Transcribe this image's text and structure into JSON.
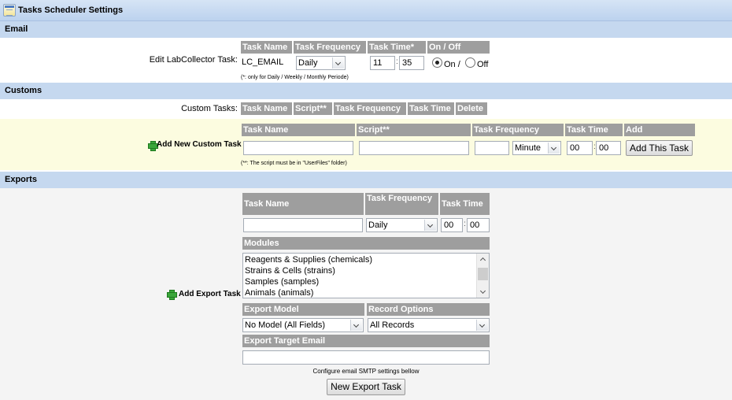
{
  "title": "Tasks Scheduler Settings",
  "email": {
    "section": "Email",
    "row_label": "Edit LabCollector Task:",
    "headers": [
      "Task Name",
      "Task Frequency",
      "Task Time*",
      "On / Off"
    ],
    "task_name": "LC_EMAIL",
    "frequency": "Daily",
    "hour": "11",
    "minute": "35",
    "on_label": "On /",
    "off_label": "Off",
    "state": "on",
    "note": "(*: only for Daily / Weekly / Monthly Periode)"
  },
  "customs": {
    "section": "Customs",
    "row_label": "Custom Tasks:",
    "headers": [
      "Task Name",
      "Script**",
      "Task Frequency",
      "Task Time",
      "Delete"
    ],
    "add_label": "Add New Custom Task",
    "add_headers": [
      "Task Name",
      "Script**",
      "Task Frequency",
      "Task Time",
      "Add"
    ],
    "task_name": "",
    "script": "",
    "frequency_value": "",
    "frequency_unit": "Minute",
    "hour": "00",
    "minute": "00",
    "add_button": "Add This Task",
    "note": "(**: The script must be in \"UserFiles\" folder)"
  },
  "exports": {
    "section": "Exports",
    "add_label": "Add Export Task",
    "headers": [
      "Task Name",
      "Task Frequency",
      "Task Time"
    ],
    "task_name": "",
    "frequency": "Daily",
    "hour": "00",
    "minute": "00",
    "modules_header": "Modules",
    "modules": [
      "Reagents & Supplies (chemicals)",
      "Strains & Cells (strains)",
      "Samples (samples)",
      "Animals (animals)"
    ],
    "export_model_header": "Export Model",
    "export_model": "No Model (All Fields)",
    "record_options_header": "Record Options",
    "record_options": "All Records",
    "target_email_header": "Export Target Email",
    "target_email": "",
    "smtp_note": "Configure email SMTP settings bellow",
    "new_button": "New Export Task"
  },
  "colors": {
    "section_bg": "#c5d8ef",
    "header_bg": "#9e9e9e",
    "custom_bg": "#fcfce0",
    "export_bg": "#f4f4f4"
  }
}
